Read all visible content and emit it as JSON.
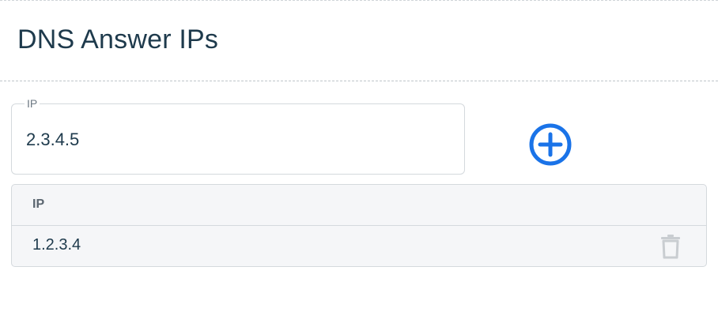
{
  "header": {
    "title": "DNS Answer IPs"
  },
  "ip_field": {
    "label": "IP",
    "value": "2.3.4.5"
  },
  "add_button": {
    "icon": "plus-circle-icon",
    "color": "#1a73e8"
  },
  "table": {
    "columns": [
      "IP"
    ],
    "rows": [
      {
        "ip": "1.2.3.4",
        "action_icon": "trash-icon"
      }
    ]
  }
}
